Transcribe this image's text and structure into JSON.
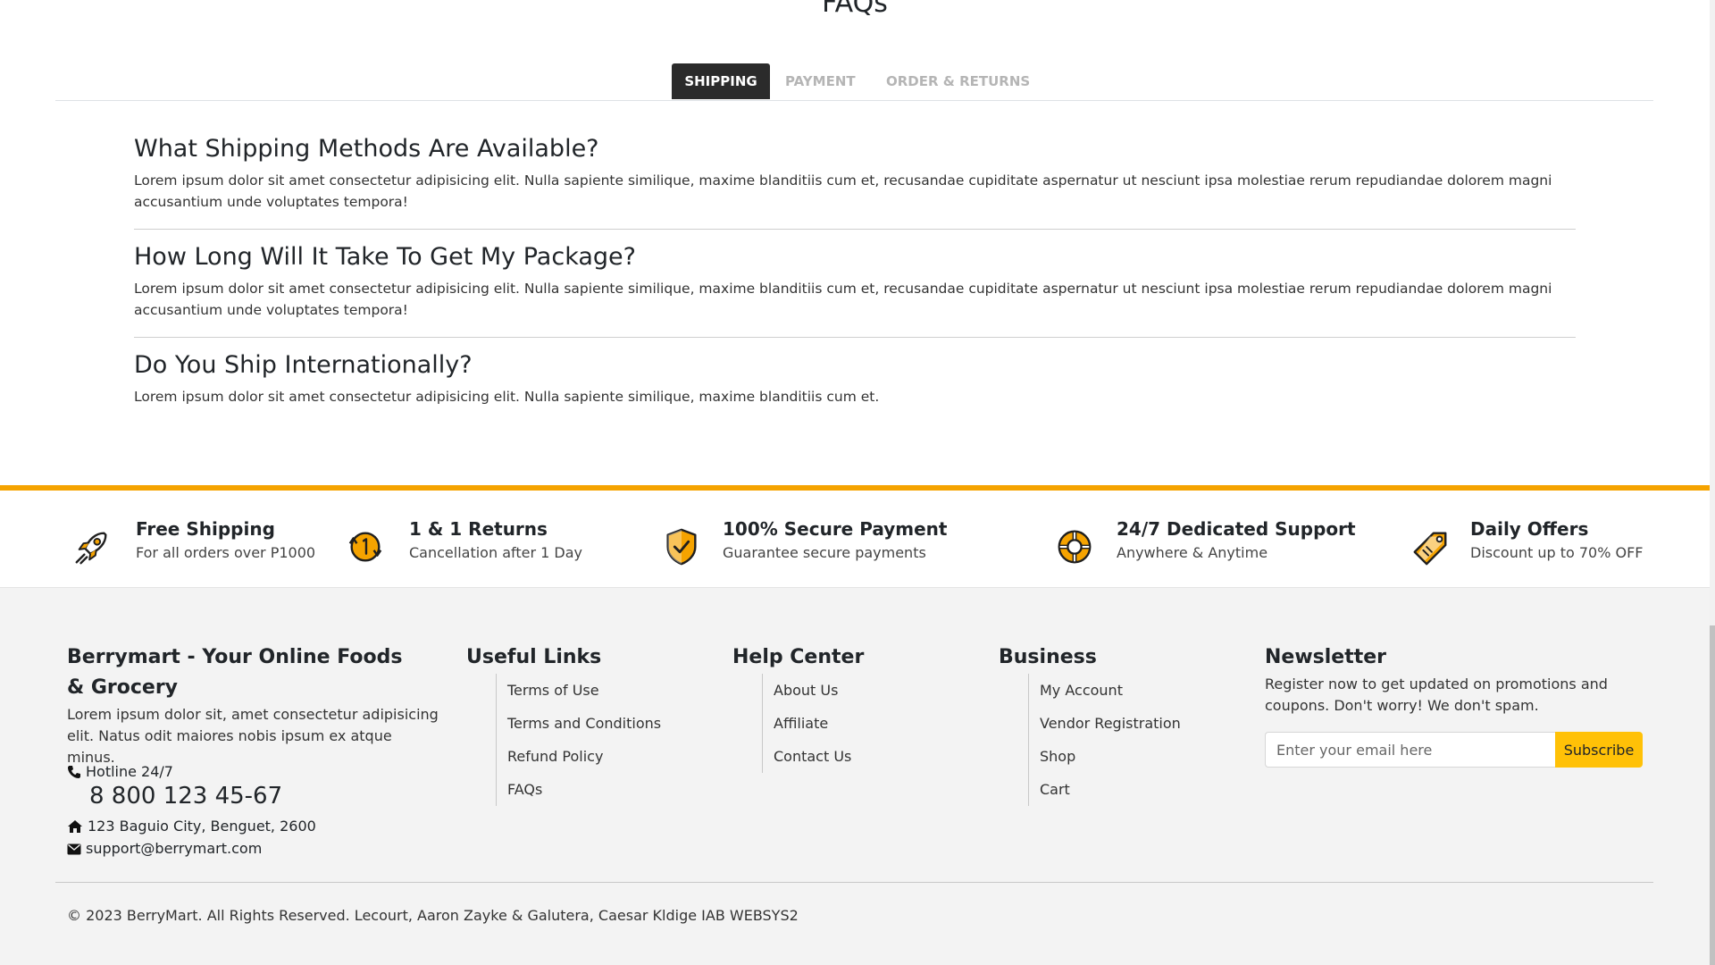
{
  "faq": {
    "title": "FAQs",
    "tabs": [
      {
        "label": "SHIPPING",
        "active": true
      },
      {
        "label": "PAYMENT",
        "active": false
      },
      {
        "label": "ORDER & RETURNS",
        "active": false
      }
    ],
    "items": [
      {
        "question": "What Shipping Methods Are Available?",
        "answer": "Lorem ipsum dolor sit amet consectetur adipisicing elit. Nulla sapiente similique, maxime blanditiis cum et, recusandae cupiditate aspernatur ut nesciunt ipsa molestiae rerum repudiandae dolorem magni accusantium unde voluptates tempora!"
      },
      {
        "question": "How Long Will It Take To Get My Package?",
        "answer": "Lorem ipsum dolor sit amet consectetur adipisicing elit. Nulla sapiente similique, maxime blanditiis cum et, recusandae cupiditate aspernatur ut nesciunt ipsa molestiae rerum repudiandae dolorem magni accusantium unde voluptates tempora!"
      },
      {
        "question": "Do You Ship Internationally?",
        "answer": "Lorem ipsum dolor sit amet consectetur adipisicing elit. Nulla sapiente similique, maxime blanditiis cum et."
      }
    ]
  },
  "features": [
    {
      "title": "Free Shipping",
      "subtitle": "For all orders over P1000",
      "icon": "rocket-icon"
    },
    {
      "title": "1 & 1 Returns",
      "subtitle": "Cancellation after 1 Day",
      "icon": "returns-icon"
    },
    {
      "title": "100% Secure Payment",
      "subtitle": "Guarantee secure payments",
      "icon": "shield-check-icon"
    },
    {
      "title": "24/7 Dedicated Support",
      "subtitle": "Anywhere & Anytime",
      "icon": "lifebuoy-icon"
    },
    {
      "title": "Daily Offers",
      "subtitle": "Discount up to 70% OFF",
      "icon": "price-tag-icon"
    }
  ],
  "footer": {
    "about": {
      "title": "Berrymart - Your Online Foods & Grocery",
      "description": "Lorem ipsum dolor sit, amet consectetur adipisicing elit. Natus odit maiores nobis ipsum ex atque minus.",
      "hotline_label": "Hotline 24/7",
      "hotline_number": "8 800 123 45-67",
      "address": "123 Baguio City, Benguet, 2600",
      "email": "support@berrymart.com"
    },
    "useful_links": {
      "title": "Useful Links",
      "links": [
        "Terms of Use",
        "Terms and Conditions",
        "Refund Policy",
        "FAQs"
      ]
    },
    "help_center": {
      "title": "Help Center",
      "links": [
        "About Us",
        "Affiliate",
        "Contact Us"
      ]
    },
    "business": {
      "title": "Business",
      "links": [
        "My Account",
        "Vendor Registration",
        "Shop",
        "Cart"
      ]
    },
    "newsletter": {
      "title": "Newsletter",
      "description": "Register now to get updated on promotions and coupons. Don't worry! We don't spam.",
      "placeholder": "Enter your email here",
      "button_label": "Subscribe"
    },
    "copyright": "© 2023 BerryMart. All Rights Reserved. Lecourt, Aaron Zayke & Galutera, Caesar Kldige IAB WEBSYS2"
  },
  "colors": {
    "accent": "#f5a300",
    "subscribe": "#ffc107",
    "active_tab": "#2b2b2b",
    "footer_bg": "#f3f3f3"
  }
}
